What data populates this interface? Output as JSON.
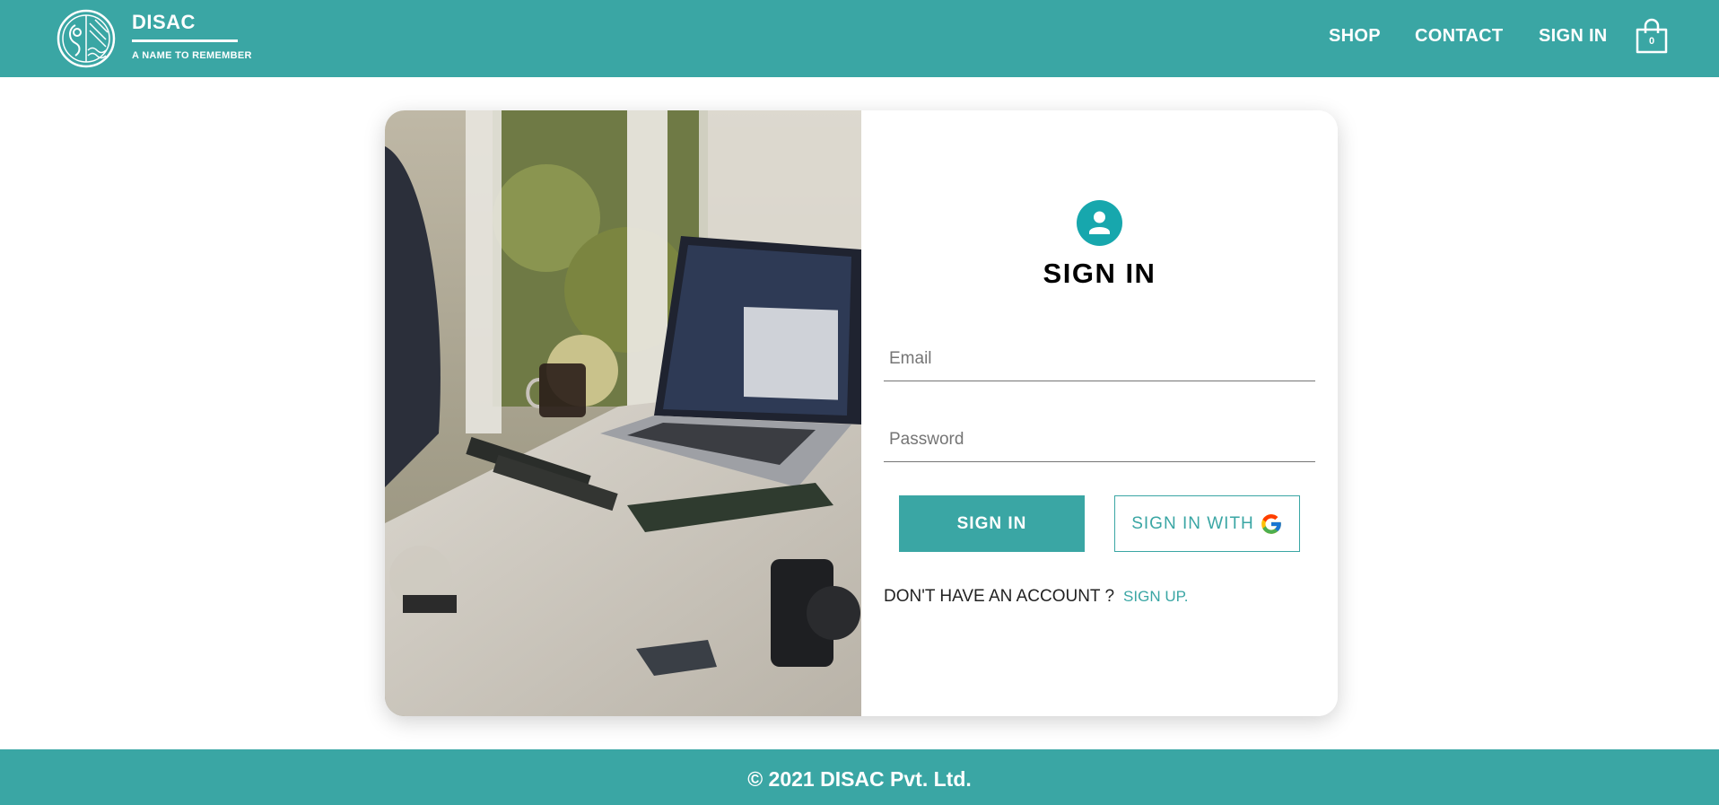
{
  "header": {
    "brand_name": "DISAC",
    "brand_tagline": "A NAME TO REMEMBER",
    "nav": {
      "shop": "SHOP",
      "contact": "CONTACT",
      "sign_in": "SIGN IN"
    },
    "cart_count": "0",
    "color": "#3aa6a4"
  },
  "photo": {
    "subject": "laptop-on-desk-photo"
  },
  "signin": {
    "title": "SIGN IN",
    "avatar_icon": "person-icon",
    "email_placeholder": "Email",
    "password_placeholder": "Password",
    "signin_button": "SIGN IN",
    "google_button": "SIGN IN WITH",
    "no_account_text": "DON'T HAVE AN ACCOUNT ?",
    "signup_link": "SIGN UP."
  },
  "footer": {
    "text": "© 2021 DISAC Pvt. Ltd."
  }
}
